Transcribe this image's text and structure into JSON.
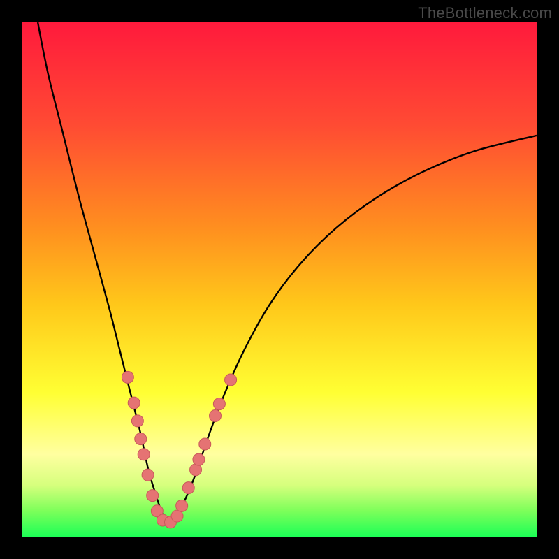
{
  "watermark": "TheBottleneck.com",
  "colors": {
    "frame": "#000000",
    "curve": "#000000",
    "dot_fill": "#e57373",
    "dot_stroke": "#c85a5a",
    "gradient_stops": [
      {
        "offset": 0.0,
        "color": "#ff1a3c"
      },
      {
        "offset": 0.2,
        "color": "#ff4b33"
      },
      {
        "offset": 0.4,
        "color": "#ff8f1f"
      },
      {
        "offset": 0.55,
        "color": "#ffc81a"
      },
      {
        "offset": 0.72,
        "color": "#ffff33"
      },
      {
        "offset": 0.84,
        "color": "#ffffa0"
      },
      {
        "offset": 0.9,
        "color": "#d6ff7d"
      },
      {
        "offset": 0.95,
        "color": "#7dff5a"
      },
      {
        "offset": 1.0,
        "color": "#1cff56"
      }
    ]
  },
  "chart_data": {
    "type": "line",
    "title": "",
    "xlabel": "",
    "ylabel": "",
    "xlim": [
      0,
      100
    ],
    "ylim": [
      0,
      100
    ],
    "series": [
      {
        "name": "curve",
        "x": [
          3,
          5,
          8,
          11,
          14,
          17,
          19,
          21,
          23,
          24.5,
          26,
          27,
          28,
          29,
          30.5,
          32,
          34,
          36,
          39,
          43,
          48,
          54,
          61,
          69,
          78,
          88,
          100
        ],
        "y": [
          100,
          90,
          78,
          66,
          55,
          44,
          36,
          28,
          20,
          13,
          8,
          5,
          3,
          3,
          5,
          8,
          13,
          19,
          27,
          36,
          45,
          53,
          60,
          66,
          71,
          75,
          78
        ]
      }
    ],
    "dots": [
      {
        "x": 20.5,
        "y": 31
      },
      {
        "x": 21.7,
        "y": 26
      },
      {
        "x": 22.4,
        "y": 22.5
      },
      {
        "x": 23.0,
        "y": 19
      },
      {
        "x": 23.6,
        "y": 16
      },
      {
        "x": 24.4,
        "y": 12
      },
      {
        "x": 25.3,
        "y": 8
      },
      {
        "x": 26.2,
        "y": 5
      },
      {
        "x": 27.3,
        "y": 3.2
      },
      {
        "x": 28.8,
        "y": 2.8
      },
      {
        "x": 30.1,
        "y": 4
      },
      {
        "x": 31.0,
        "y": 6
      },
      {
        "x": 32.3,
        "y": 9.5
      },
      {
        "x": 33.7,
        "y": 13
      },
      {
        "x": 34.3,
        "y": 15
      },
      {
        "x": 35.5,
        "y": 18
      },
      {
        "x": 37.5,
        "y": 23.5
      },
      {
        "x": 38.3,
        "y": 25.8
      },
      {
        "x": 40.5,
        "y": 30.5
      }
    ]
  }
}
